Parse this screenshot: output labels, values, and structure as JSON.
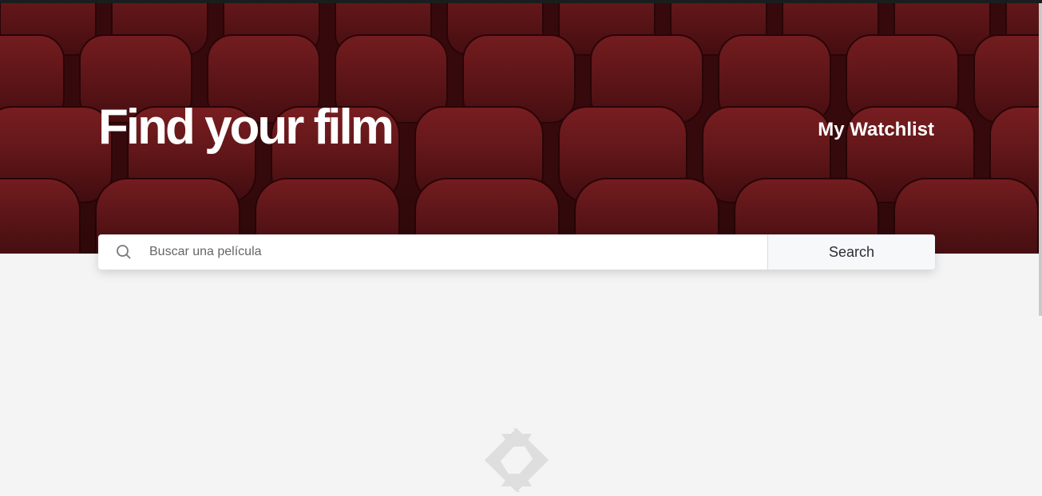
{
  "header": {
    "title": "Find your film",
    "watchlist_label": "My Watchlist"
  },
  "search": {
    "placeholder": "Buscar una película",
    "value": "",
    "button_label": "Search",
    "icon": "search-icon"
  },
  "content": {
    "loading_icon": "aperture-spinner-icon"
  },
  "colors": {
    "hero_base": "#3a0b0d",
    "seat": "#7a1c1f",
    "page_background": "#f4f4f4",
    "spinner": "#dedede"
  }
}
